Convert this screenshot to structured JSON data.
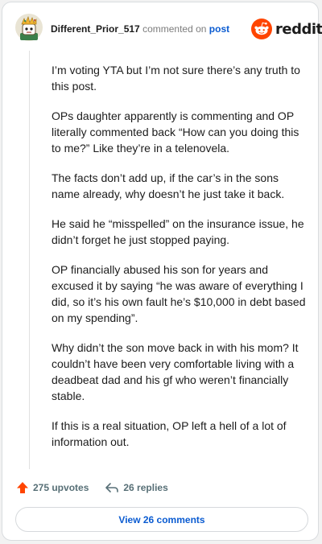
{
  "header": {
    "username": "Different_Prior_517",
    "action_text": "commented on",
    "post_link": "post",
    "brand": "reddit"
  },
  "comment": {
    "paragraphs": [
      "I’m voting YTA but I’m not sure there’s any truth to this post.",
      "OPs daughter apparently is commenting and OP literally commented back “How can you doing this to me?” Like they’re in a telenovela.",
      "The facts don’t add up, if the car’s in the sons name already, why doesn’t he just take it back.",
      "He said he “misspelled” on the insurance issue, he didn’t forget he just stopped paying.",
      "OP financially abused his son for years and excused it by saying “he was aware of everything I did, so it’s his own fault he’s $10,000 in debt based on my spending”.",
      "Why didn’t the son move back in with his mom? It couldn’t have been very comfortable living with a deadbeat dad and his gf who weren’t financially stable.",
      "If this is a real situation, OP left a hell of a lot of information out."
    ]
  },
  "footer": {
    "upvotes_label": "275 upvotes",
    "replies_label": "26 replies",
    "view_comments_label": "View 26 comments"
  },
  "icons": {
    "avatar": "avatar-icon",
    "brand": "reddit-snoo-icon",
    "upvote": "upvote-arrow-icon",
    "reply": "reply-arrow-icon"
  },
  "colors": {
    "upvote": "#ff4500",
    "link": "#0a5bd1",
    "brand": "#ff4500",
    "muted": "#7c7c7c"
  }
}
